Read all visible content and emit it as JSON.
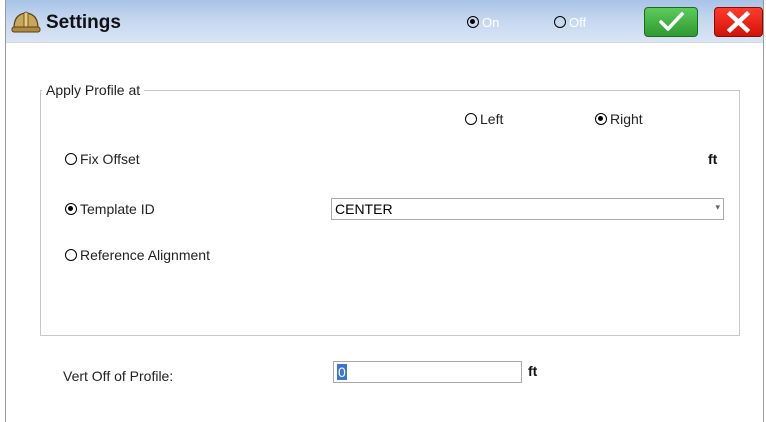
{
  "window": {
    "title": "Settings"
  },
  "title_toggle": {
    "on_label": "On",
    "off_label": "Off",
    "selected": "on"
  },
  "actions": {
    "ok_icon": "checkmark-icon",
    "close_icon": "x-icon"
  },
  "apply_profile": {
    "legend": "Apply Profile at",
    "side_left": "Left",
    "side_right": "Right",
    "side_selected": "right",
    "fix_offset": "Fix Offset",
    "fix_offset_unit": "ft",
    "template_id": "Template ID",
    "template_id_value": "CENTER",
    "reference_alignment": "Reference Alignment",
    "mode_selected": "template_id"
  },
  "vert_off": {
    "label": "Vert Off of Profile:",
    "value": "0",
    "unit": "ft"
  },
  "colors": {
    "ok": "#2f9a2f",
    "close": "#e0160b",
    "titlebar": "#b7cdea"
  }
}
